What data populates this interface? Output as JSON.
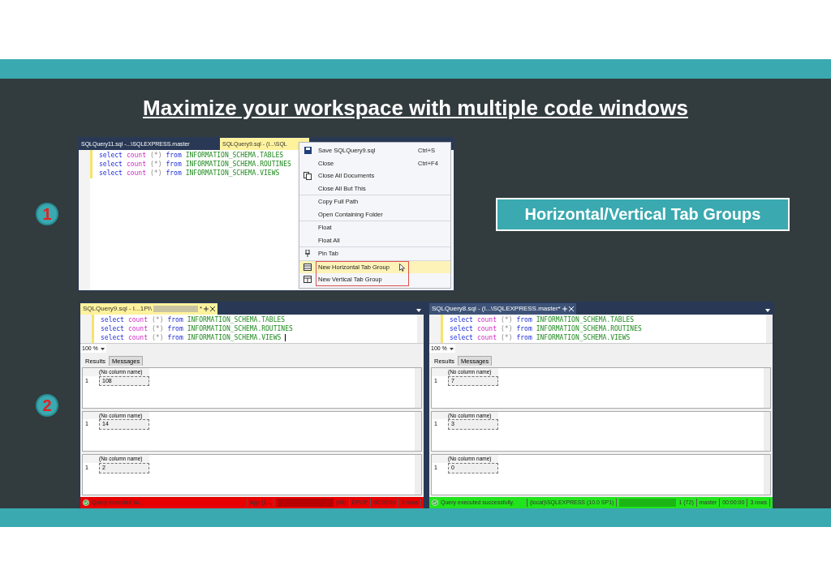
{
  "title": "Maximize your workspace with multiple code windows",
  "steps": [
    {
      "number": "1"
    },
    {
      "number": "2"
    }
  ],
  "callout": "Horizontal/Vertical Tab Groups",
  "screenshot_1": {
    "tabs": [
      {
        "label": "SQLQuery11.sql -...\\SQLEXPRESS.master",
        "selected": false
      },
      {
        "label": "SQLQuery9.sql - (l...\\SQL",
        "selected": true
      }
    ],
    "code": [
      [
        {
          "kind": "keyword",
          "text": "select"
        },
        {
          "kind": "function",
          "text": "count"
        },
        {
          "kind": "operator",
          "text": "(*)"
        },
        {
          "kind": "keyword",
          "text": "from"
        },
        {
          "kind": "identifier",
          "text": "INFORMATION_SCHEMA.TABLES"
        }
      ],
      [
        {
          "kind": "keyword",
          "text": "select"
        },
        {
          "kind": "function",
          "text": "count"
        },
        {
          "kind": "operator",
          "text": "(*)"
        },
        {
          "kind": "keyword",
          "text": "from"
        },
        {
          "kind": "identifier",
          "text": "INFORMATION_SCHEMA.ROUTINES"
        }
      ],
      [
        {
          "kind": "keyword",
          "text": "select"
        },
        {
          "kind": "function",
          "text": "count"
        },
        {
          "kind": "operator",
          "text": "(*)"
        },
        {
          "kind": "keyword",
          "text": "from"
        },
        {
          "kind": "identifier",
          "text": "INFORMATION_SCHEMA.VIEWS"
        }
      ]
    ],
    "context_menu": {
      "groups": [
        {
          "items": [
            {
              "label": "Save SQLQuery9.sql",
              "shortcut": "Ctrl+S",
              "kind": "save",
              "selected": false
            },
            {
              "label": "Close",
              "shortcut": "Ctrl+F4",
              "selected": false
            },
            {
              "label": "Close All Documents",
              "kind": "documents",
              "selected": false
            },
            {
              "label": "Close All But This",
              "selected": false
            }
          ]
        },
        {
          "items": [
            {
              "label": "Copy Full Path",
              "selected": false
            },
            {
              "label": "Open Containing Folder",
              "selected": false
            }
          ]
        },
        {
          "items": [
            {
              "label": "Float",
              "selected": false
            },
            {
              "label": "Float All",
              "selected": false
            }
          ]
        },
        {
          "items": [
            {
              "label": "Pin Tab",
              "kind": "pin",
              "selected": false
            }
          ]
        },
        {
          "outlined": true,
          "items": [
            {
              "label": "New Horizontal Tab Group",
              "kind": "horizontal",
              "selected": true
            },
            {
              "label": "New Vertical Tab Group",
              "kind": "vertical",
              "selected": false
            }
          ]
        }
      ]
    }
  },
  "panes": [
    {
      "tab": "SQLQuery9.sql - I...1PI\\",
      "redacted": true,
      "suffix": "*",
      "cursor": true,
      "code": [
        [
          {
            "kind": "keyword",
            "text": "select"
          },
          {
            "kind": "function",
            "text": "count"
          },
          {
            "kind": "operator",
            "text": "(*)"
          },
          {
            "kind": "keyword",
            "text": "from"
          },
          {
            "kind": "identifier",
            "text": "INFORMATION_SCHEMA.TABLES"
          }
        ],
        [
          {
            "kind": "keyword",
            "text": "select"
          },
          {
            "kind": "function",
            "text": "count"
          },
          {
            "kind": "operator",
            "text": "(*)"
          },
          {
            "kind": "keyword",
            "text": "from"
          },
          {
            "kind": "identifier",
            "text": "INFORMATION_SCHEMA.ROUTINES"
          }
        ],
        [
          {
            "kind": "keyword",
            "text": "select"
          },
          {
            "kind": "function",
            "text": "count"
          },
          {
            "kind": "operator",
            "text": "(*)"
          },
          {
            "kind": "keyword",
            "text": "from"
          },
          {
            "kind": "identifier",
            "text": "INFORMATION_SCHEMA.VIEWS"
          }
        ]
      ],
      "zoom": "100 %",
      "result_tabs": [
        {
          "label": "Results",
          "selected": true
        },
        {
          "label": "Messages",
          "selected": false
        }
      ],
      "results": [
        {
          "column": "(No column name)",
          "row": "1",
          "value": "108"
        },
        {
          "column": "(No column name)",
          "row": "1",
          "value": "14"
        },
        {
          "column": "(No column name)",
          "row": "1",
          "value": "2"
        }
      ],
      "color": "#e60000",
      "status": [
        {
          "kind": "text",
          "text": "Query executed su..."
        },
        {
          "kind": "text",
          "text": "App (1..."
        },
        {
          "kind": "redacted"
        },
        {
          "kind": "text",
          "text": "(98)"
        },
        {
          "kind": "text",
          "text": "EPOP"
        },
        {
          "kind": "text",
          "text": "00:00:00"
        },
        {
          "kind": "text",
          "text": "3 rows"
        }
      ]
    },
    {
      "tab": "SQLQuery8.sql - (l...\\SQLEXPRESS.master*",
      "code": [
        [
          {
            "kind": "keyword",
            "text": "select"
          },
          {
            "kind": "function",
            "text": "count"
          },
          {
            "kind": "operator",
            "text": "(*)"
          },
          {
            "kind": "keyword",
            "text": "from"
          },
          {
            "kind": "identifier",
            "text": "INFORMATION_SCHEMA.TABLES"
          }
        ],
        [
          {
            "kind": "keyword",
            "text": "select"
          },
          {
            "kind": "function",
            "text": "count"
          },
          {
            "kind": "operator",
            "text": "(*)"
          },
          {
            "kind": "keyword",
            "text": "from"
          },
          {
            "kind": "identifier",
            "text": "INFORMATION_SCHEMA.ROUTINES"
          }
        ],
        [
          {
            "kind": "keyword",
            "text": "select"
          },
          {
            "kind": "function",
            "text": "count"
          },
          {
            "kind": "operator",
            "text": "(*)"
          },
          {
            "kind": "keyword",
            "text": "from"
          },
          {
            "kind": "identifier",
            "text": "INFORMATION_SCHEMA.VIEWS"
          }
        ]
      ],
      "zoom": "100 %",
      "result_tabs": [
        {
          "label": "Results",
          "selected": true
        },
        {
          "label": "Messages",
          "selected": false
        }
      ],
      "results": [
        {
          "column": "(No column name)",
          "row": "1",
          "value": "7"
        },
        {
          "column": "(No column name)",
          "row": "1",
          "value": "3"
        },
        {
          "column": "(No column name)",
          "row": "1",
          "value": "0"
        }
      ],
      "color": "#22e41c",
      "status": [
        {
          "kind": "text",
          "text": "Query executed successfully."
        },
        {
          "kind": "text",
          "text": "(local)\\SQLEXPRESS (10.0 SP1)"
        },
        {
          "kind": "redacted"
        },
        {
          "kind": "text",
          "text": "1 (72)"
        },
        {
          "kind": "text",
          "text": "master"
        },
        {
          "kind": "text",
          "text": "00:00:00"
        },
        {
          "kind": "text",
          "text": "3 rows"
        }
      ]
    }
  ]
}
